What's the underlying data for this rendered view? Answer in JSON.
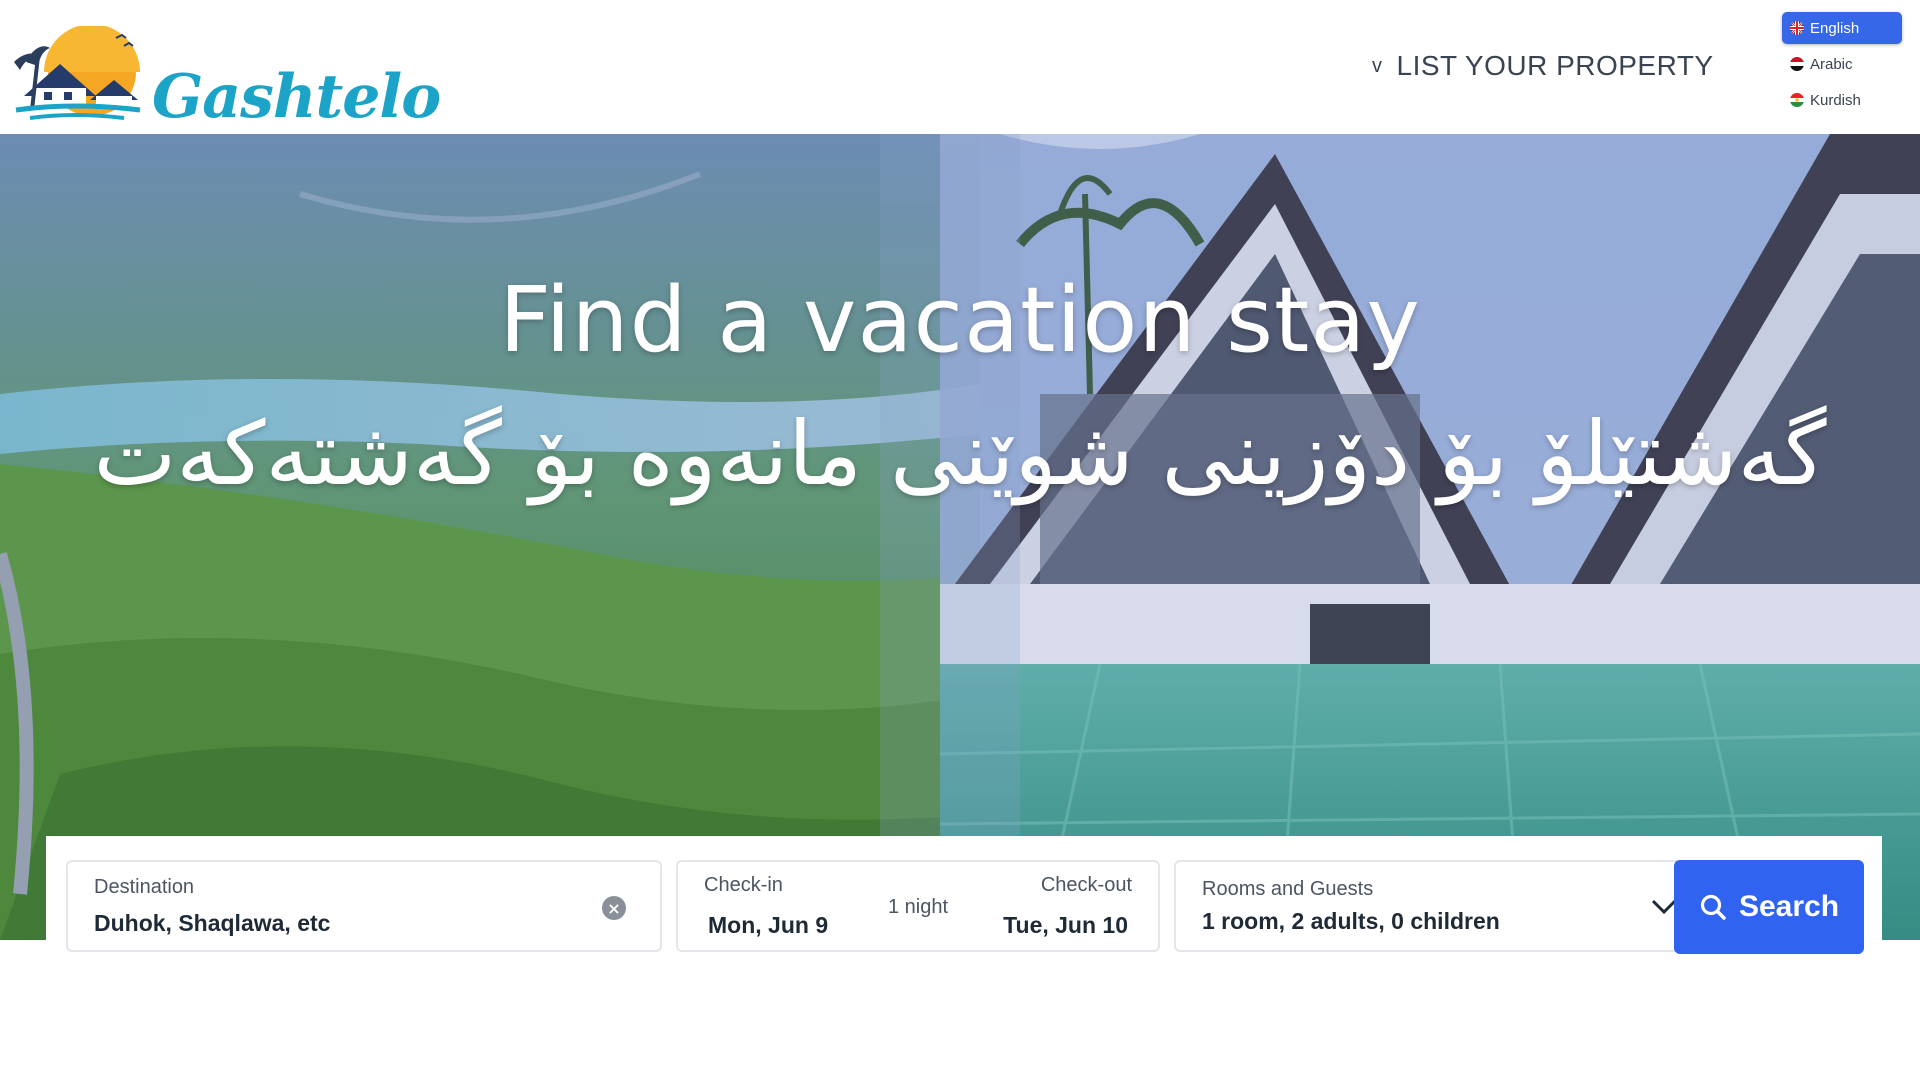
{
  "brand": {
    "name": "Gashtelo"
  },
  "header": {
    "list_property": "LIST YOUR PROPERTY"
  },
  "languages": [
    {
      "label": "English",
      "active": true
    },
    {
      "label": "Arabic",
      "active": false
    },
    {
      "label": "Kurdish",
      "active": false
    }
  ],
  "hero": {
    "title": "Find a vacation stay",
    "subtitle": "گەشتێلۆ بۆ دۆزینی شوێنی مانەوە بۆ گەشتەکەت"
  },
  "search": {
    "destination_label": "Destination",
    "destination_value": "Duhok, Shaqlawa, etc",
    "checkin_label": "Check-in",
    "checkin_value": "Mon, Jun 9",
    "nights": "1 night",
    "checkout_label": "Check-out",
    "checkout_value": "Tue, Jun 10",
    "rooms_label": "Rooms and Guests",
    "rooms_value": "1 room, 2 adults, 0 children",
    "button_label": "Search"
  },
  "colors": {
    "brand": "#1ba3c8",
    "accent": "#2f63f0",
    "active_lang": "#3567e8"
  },
  "icons": [
    "logo-icon",
    "chevron-down-icon",
    "uk-flag-icon",
    "iraq-flag-icon",
    "kurdistan-flag-icon",
    "clear-icon",
    "search-icon"
  ]
}
